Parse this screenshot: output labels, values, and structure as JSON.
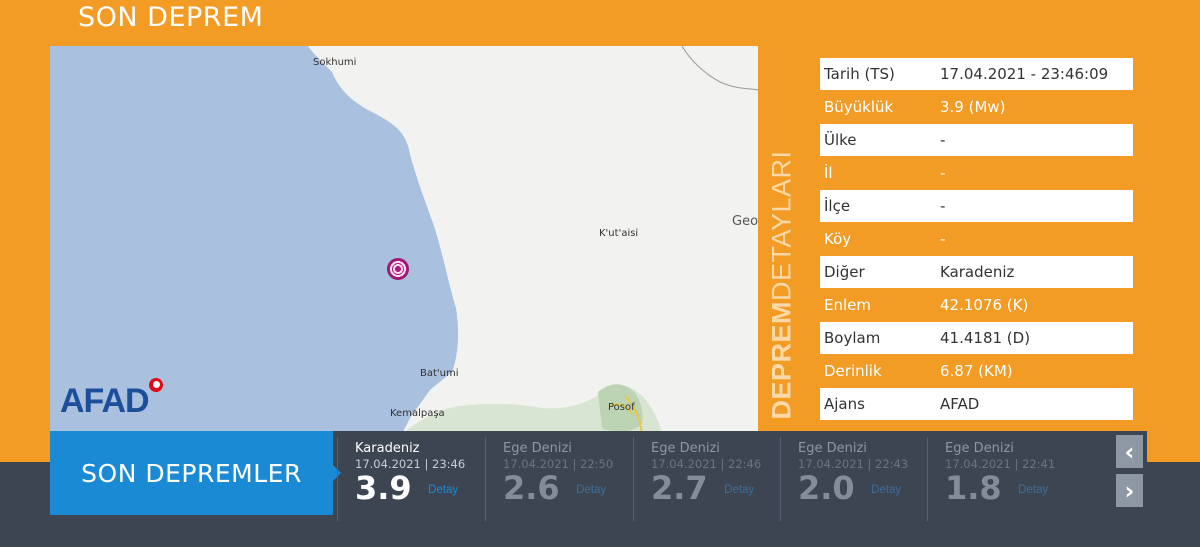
{
  "page": {
    "title": "SON DEPREM"
  },
  "map": {
    "labels": {
      "sokhumi": "Sokhumi",
      "kutaisi": "K'ut'aisi",
      "batumi": "Bat'umi",
      "kemalpasa": "Kemalpaşa",
      "posof": "Posof",
      "geo": "Geo"
    },
    "logo": "AFAD"
  },
  "vertical_label": {
    "strong": "DEPREM",
    "light": "DETAYLARI"
  },
  "details": [
    {
      "key": "Tarih (TS)",
      "value": "17.04.2021 - 23:46:09"
    },
    {
      "key": "Büyüklük",
      "value": "3.9 (Mw)"
    },
    {
      "key": "Ülke",
      "value": "-"
    },
    {
      "key": "İl",
      "value": "-"
    },
    {
      "key": "İlçe",
      "value": "-"
    },
    {
      "key": "Köy",
      "value": "-"
    },
    {
      "key": "Diğer",
      "value": "Karadeniz"
    },
    {
      "key": "Enlem",
      "value": "42.1076 (K)"
    },
    {
      "key": "Boylam",
      "value": "41.4181 (D)"
    },
    {
      "key": "Derinlik",
      "value": "6.87 (KM)"
    },
    {
      "key": "Ajans",
      "value": "AFAD"
    }
  ],
  "bar": {
    "title": "SON DEPREMLER",
    "prev": "‹",
    "next": "›",
    "items": [
      {
        "place": "Karadeniz",
        "date": "17.04.2021 | 23:46",
        "mag": "3.9",
        "detail": "Detay"
      },
      {
        "place": "Ege Denizi",
        "date": "17.04.2021 | 22:50",
        "mag": "2.6",
        "detail": "Detay"
      },
      {
        "place": "Ege Denizi",
        "date": "17.04.2021 | 22:46",
        "mag": "2.7",
        "detail": "Detay"
      },
      {
        "place": "Ege Denizi",
        "date": "17.04.2021 | 22:43",
        "mag": "2.0",
        "detail": "Detay"
      },
      {
        "place": "Ege Denizi",
        "date": "17.04.2021 | 22:41",
        "mag": "1.8",
        "detail": "Detay"
      }
    ]
  },
  "colors": {
    "accent": "#f29b25",
    "sea": "#a9c0df",
    "dark": "#3e4552",
    "blue": "#1a8ad4"
  }
}
